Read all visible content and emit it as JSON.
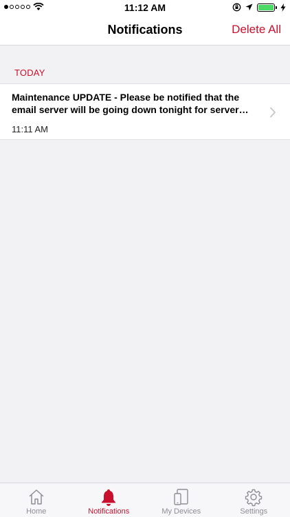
{
  "status_bar": {
    "time": "11:12 AM",
    "signal_dots": [
      true,
      false,
      false,
      false,
      false
    ],
    "icons": [
      "wifi-icon",
      "orientation-lock-icon",
      "location-icon",
      "battery-icon",
      "charging-icon"
    ],
    "battery_color": "#4cd964"
  },
  "nav": {
    "title": "Notifications",
    "action_label": "Delete All"
  },
  "section": {
    "header": "TODAY"
  },
  "notifications": [
    {
      "title_line1": "Maintenance UPDATE - Please be notified that the",
      "title_line2": "email server will be going down tonight for server…",
      "time": "11:11 AM"
    }
  ],
  "tab_bar": {
    "tabs": [
      {
        "label": "Home",
        "icon": "home-icon",
        "active": false
      },
      {
        "label": "Notifications",
        "icon": "bell-icon",
        "active": true
      },
      {
        "label": "My Devices",
        "icon": "devices-icon",
        "active": false
      },
      {
        "label": "Settings",
        "icon": "gear-icon",
        "active": false
      }
    ]
  },
  "colors": {
    "accent": "#c8102e",
    "inactive": "#8e8e93",
    "background": "#f2f2f5"
  }
}
